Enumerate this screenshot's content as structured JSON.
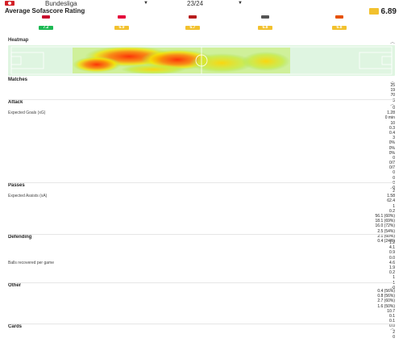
{
  "header": {
    "competition": "Bundesliga",
    "season": "23/24",
    "title": "Average Sofascore Rating",
    "rating": "6.89"
  },
  "matches": [
    {
      "rating": "7.2",
      "color": "#1db954"
    },
    {
      "rating": "6.9",
      "color": "#f2c12e"
    },
    {
      "rating": "6.7",
      "color": "#f2c12e"
    },
    {
      "rating": "6.8",
      "color": "#f2c12e"
    },
    {
      "rating": "6.8",
      "color": "#f2c12e"
    }
  ],
  "heatmap": {
    "label": "Heatmap"
  },
  "sections": [
    {
      "title": "Matches",
      "rows": [
        {
          "label": "",
          "value": "25"
        },
        {
          "label": "",
          "value": "19"
        },
        {
          "label": "",
          "value": "70"
        },
        {
          "label": "",
          "value": "3"
        }
      ]
    },
    {
      "title": "Attack",
      "rows": [
        {
          "label": "",
          "value": "0"
        },
        {
          "label": "Expected Goals (xG)",
          "value": "1.28"
        },
        {
          "label": "",
          "value": "0 min"
        },
        {
          "label": "",
          "value": "10"
        },
        {
          "label": "",
          "value": "0.3"
        },
        {
          "label": "",
          "value": "0.4"
        },
        {
          "label": "",
          "value": "3"
        },
        {
          "label": "",
          "value": "0%"
        },
        {
          "label": "",
          "value": "0%"
        },
        {
          "label": "",
          "value": "0%"
        },
        {
          "label": "",
          "value": "0"
        },
        {
          "label": "",
          "value": "0/7"
        },
        {
          "label": "",
          "value": "0/7"
        },
        {
          "label": "",
          "value": "0"
        },
        {
          "label": "",
          "value": "0"
        },
        {
          "label": "",
          "value": "0"
        },
        {
          "label": "",
          "value": "0"
        }
      ]
    },
    {
      "title": "Passes",
      "rows": [
        {
          "label": "",
          "value": "2"
        },
        {
          "label": "Expected Assists (xA)",
          "value": "1.58"
        },
        {
          "label": "",
          "value": "62.4"
        },
        {
          "label": "",
          "value": "1"
        },
        {
          "label": "",
          "value": "0.2"
        },
        {
          "label": "",
          "value": "56.1 (60%)"
        },
        {
          "label": "",
          "value": "18.1 (69%)"
        },
        {
          "label": "",
          "value": "16.0 (72%)"
        },
        {
          "label": "",
          "value": "2.5 (54%)"
        },
        {
          "label": "",
          "value": "2.1 (60%)"
        },
        {
          "label": "",
          "value": "0.4 (24%)"
        }
      ]
    },
    {
      "title": "Defending",
      "rows": [
        {
          "label": "",
          "value": "1.2"
        },
        {
          "label": "",
          "value": "4.1"
        },
        {
          "label": "",
          "value": "0.9"
        },
        {
          "label": "",
          "value": "0.0"
        },
        {
          "label": "Balls recovered per game",
          "value": "4.6"
        },
        {
          "label": "",
          "value": "1.9"
        },
        {
          "label": "",
          "value": "0.2"
        },
        {
          "label": "",
          "value": "1"
        },
        {
          "label": "",
          "value": "1"
        },
        {
          "label": "",
          "value": "0"
        }
      ]
    },
    {
      "title": "Other",
      "rows": [
        {
          "label": "",
          "value": "0.4 (56%)"
        },
        {
          "label": "",
          "value": "0.8 (56%)"
        },
        {
          "label": "",
          "value": "2.7 (60%)"
        },
        {
          "label": "",
          "value": "1.6 (50%)"
        },
        {
          "label": "",
          "value": "10.7"
        },
        {
          "label": "",
          "value": "0.1"
        },
        {
          "label": "",
          "value": "0.1"
        },
        {
          "label": "",
          "value": "0.0"
        }
      ]
    },
    {
      "title": "Cards",
      "rows": [
        {
          "label": "",
          "value": "2"
        },
        {
          "label": "",
          "value": "0"
        }
      ]
    }
  ]
}
